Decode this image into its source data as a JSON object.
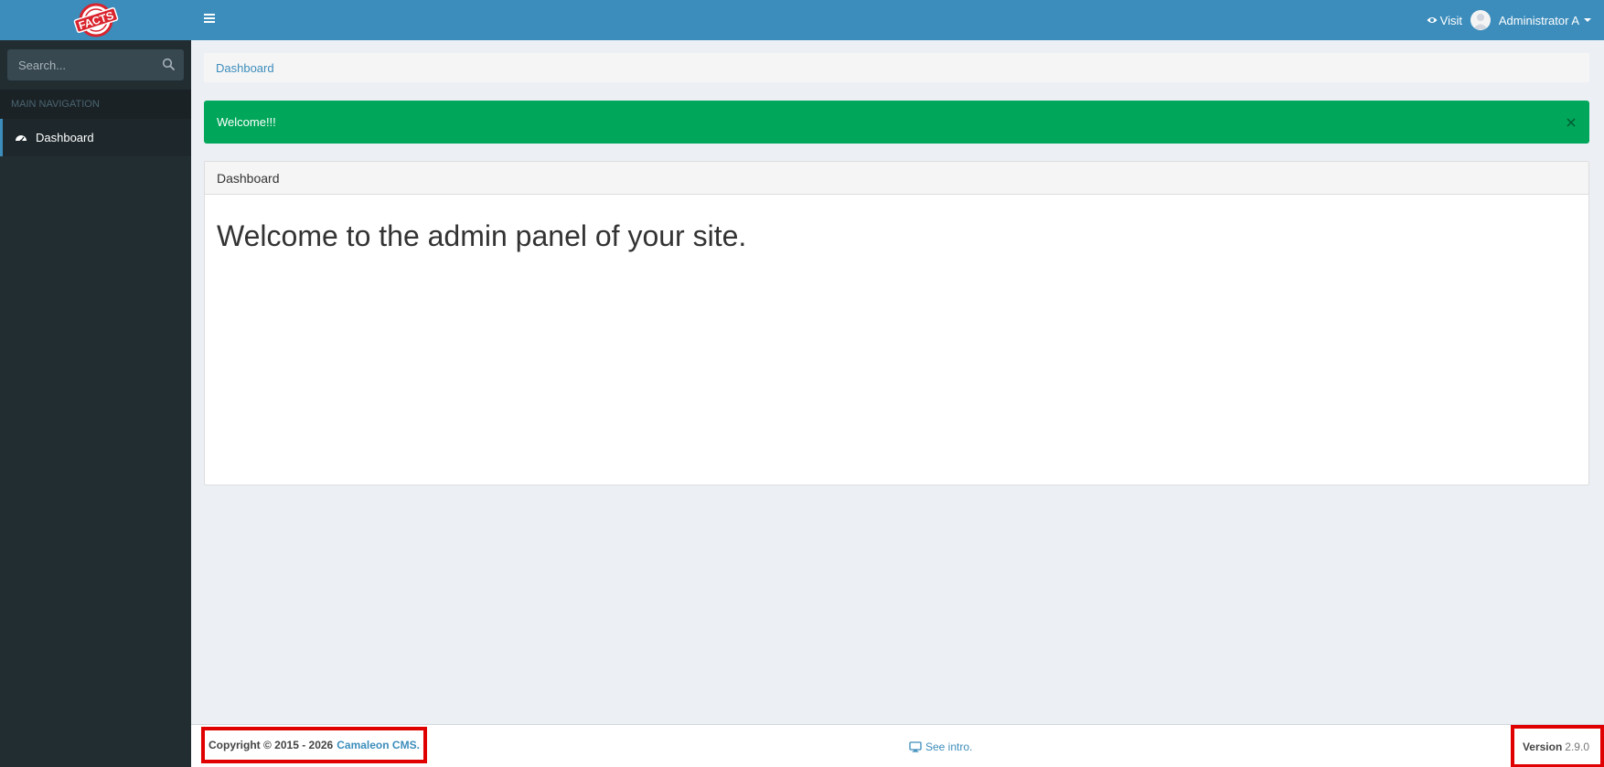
{
  "brand": {
    "logo_text": "FACTS"
  },
  "sidebar": {
    "search_placeholder": "Search...",
    "nav_header": "MAIN NAVIGATION",
    "items": [
      {
        "label": "Dashboard",
        "icon": "dashboard-icon",
        "active": true
      }
    ]
  },
  "topbar": {
    "visit_label": "Visit",
    "user_name": "Administrator A"
  },
  "breadcrumb": {
    "current": "Dashboard"
  },
  "alert": {
    "message": "Welcome!!!",
    "close_symbol": "×"
  },
  "panel": {
    "title": "Dashboard",
    "heading": "Welcome to the admin panel of your site."
  },
  "footer": {
    "copyright_prefix": "Copyright © 2015 - 2026",
    "cms_link": "Camaleon CMS.",
    "intro_link": "See intro.",
    "version_label": "Version",
    "version_number": "2.9.0"
  },
  "colors": {
    "primary": "#3c8dbc",
    "sidebar_bg": "#222d32",
    "success": "#00a65a",
    "highlight_box": "#e00000"
  }
}
